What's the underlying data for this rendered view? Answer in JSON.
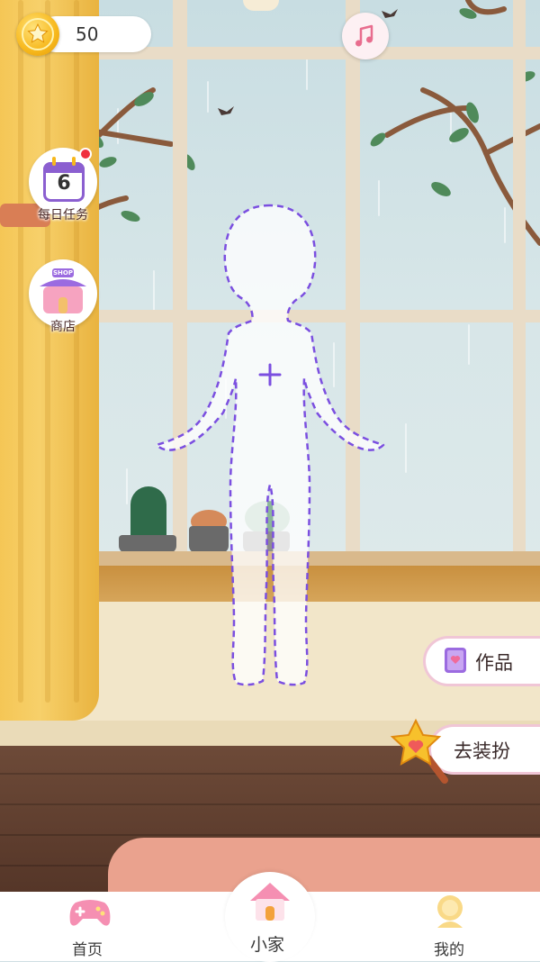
{
  "hud": {
    "coins": "50",
    "coin_icon": "star-coin-icon",
    "music_icon": "music-note-icon"
  },
  "side_menu": {
    "daily_tasks": {
      "label": "每日任务",
      "day": "6",
      "has_notification": true
    },
    "shop": {
      "label": "商店",
      "sign": "SHOP"
    }
  },
  "actions": {
    "works_label": "作品",
    "dress_up_label": "去装扮"
  },
  "tabbar": {
    "tabs": [
      {
        "label": "首页",
        "icon": "gamepad-icon",
        "active": false
      },
      {
        "label": "小家",
        "icon": "house-icon",
        "active": true
      },
      {
        "label": "我的",
        "icon": "avatar-icon",
        "active": false
      }
    ]
  },
  "colors": {
    "accent_purple": "#8b5fd0",
    "accent_pink": "#f0c6d6",
    "coin_gold": "#f7b81c",
    "notification_red": "#f0303d"
  }
}
